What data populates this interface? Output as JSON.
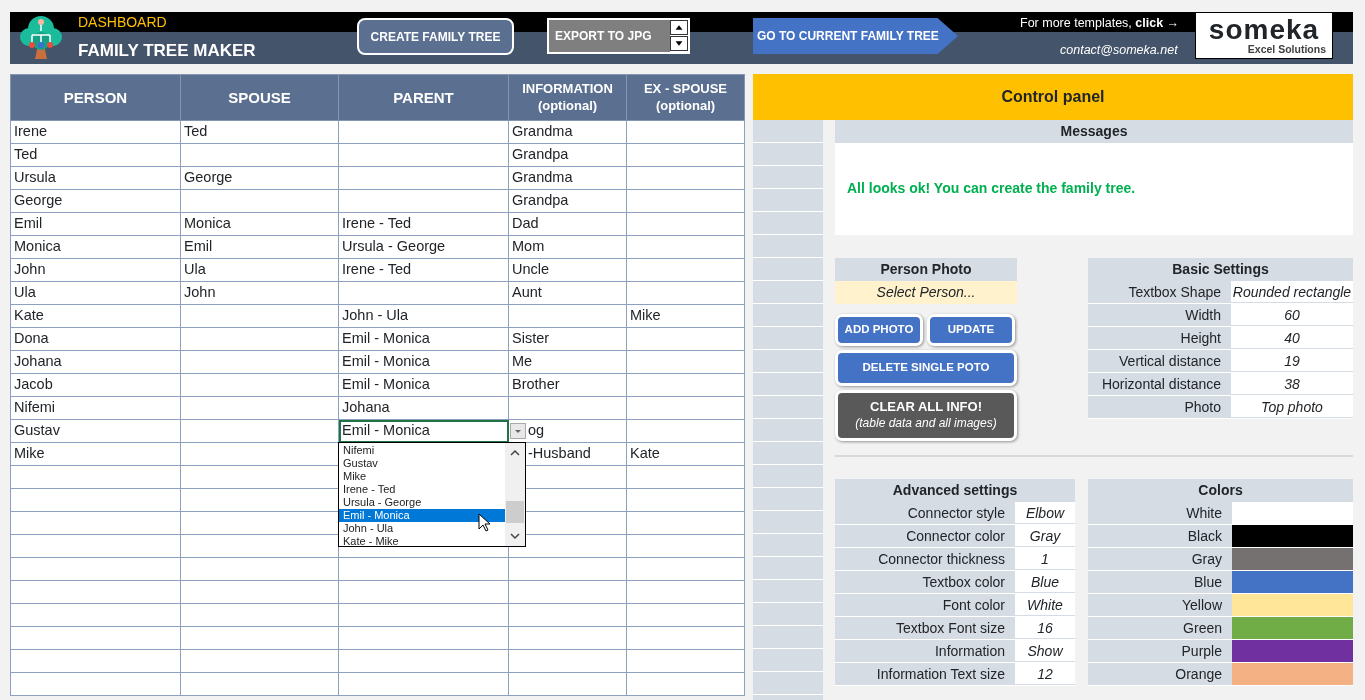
{
  "header": {
    "section": "DASHBOARD",
    "title": "FAMILY TREE MAKER",
    "create_button": "CREATE FAMILY TREE",
    "export_button": "EXPORT TO JPG",
    "go_button": "GO TO  CURRENT FAMILY TREE",
    "more_templates": "For more templates, **click** →",
    "contact": "contact@someka.net",
    "logo": {
      "name": "someka",
      "tagline": "Excel Solutions"
    }
  },
  "table": {
    "columns": [
      "PERSON",
      "SPOUSE",
      "PARENT",
      "INFORMATION (optional)",
      "EX - SPOUSE (optional)"
    ],
    "rows": [
      {
        "person": "Irene",
        "spouse": "Ted",
        "information": "Grandma"
      },
      {
        "person": "Ted",
        "information": "Grandpa"
      },
      {
        "person": "Ursula",
        "spouse": "George",
        "information": "Grandma"
      },
      {
        "person": "George",
        "information": "Grandpa"
      },
      {
        "person": "Emil",
        "spouse": "Monica",
        "parent": "Irene - Ted",
        "information": "Dad"
      },
      {
        "person": "Monica",
        "spouse": "Emil",
        "parent": "Ursula - George",
        "information": "Mom"
      },
      {
        "person": "John",
        "spouse": "Ula",
        "parent": "Irene - Ted",
        "information": "Uncle"
      },
      {
        "person": "Ula",
        "spouse": "John",
        "information": "Aunt"
      },
      {
        "person": "Kate",
        "parent": "John - Ula",
        "ex_spouse": "Mike"
      },
      {
        "person": "Dona",
        "parent": "Emil - Monica",
        "information": "Sister"
      },
      {
        "person": "Johana",
        "parent": "Emil - Monica",
        "information": "Me"
      },
      {
        "person": "Jacob",
        "parent": "Emil - Monica",
        "information": "Brother"
      },
      {
        "person": "Nifemi",
        "parent": "Johana"
      },
      {
        "person": "Gustav",
        "parent": "Emil - Monica",
        "information": "og",
        "parent_dropdown": [
          {
            "label": "Nifemi",
            "selected": false
          },
          {
            "label": "Gustav",
            "selected": false
          },
          {
            "label": "Mike",
            "selected": false
          },
          {
            "label": "Irene - Ted",
            "selected": false
          },
          {
            "label": "Ursula - George",
            "selected": false
          },
          {
            "label": "Emil - Monica",
            "selected": true
          },
          {
            "label": "John - Ula",
            "selected": false
          },
          {
            "label": "Kate - Mike",
            "selected": false
          }
        ]
      },
      {
        "person": "Mike",
        "information": "-Husband",
        "ex_spouse": "Kate"
      }
    ]
  },
  "control_panel": {
    "title": "Control panel",
    "messages": {
      "title": "Messages",
      "text": "All looks ok! You can create the family tree."
    },
    "person_photo": {
      "title": "Person Photo",
      "placeholder": "Select Person..."
    },
    "buttons": [
      {
        "kind": "small",
        "label": "ADD PHOTO"
      },
      {
        "kind": "small",
        "label": "UPDATE"
      },
      {
        "kind": "wide",
        "label": "DELETE SINGLE POTO"
      },
      {
        "kind": "danger",
        "label": "CLEAR ALL INFO!",
        "note": "(table data and all images)"
      }
    ],
    "basic_settings": {
      "title": "Basic Settings",
      "rows": [
        {
          "label": "Textbox Shape",
          "value": "Rounded rectangle"
        },
        {
          "label": "Width",
          "value": "60"
        },
        {
          "label": "Height",
          "value": "40"
        },
        {
          "label": "Vertical distance",
          "value": "19"
        },
        {
          "label": "Horizontal distance",
          "value": "38"
        },
        {
          "label": "Photo",
          "value": "Top photo"
        }
      ]
    },
    "advanced_settings": {
      "title": "Advanced settings",
      "rows": [
        {
          "label": "Connector style",
          "value": "Elbow"
        },
        {
          "label": "Connector color",
          "value": "Gray"
        },
        {
          "label": "Connector thickness",
          "value": "1"
        },
        {
          "label": "Textbox color",
          "value": "Blue"
        },
        {
          "label": "Font color",
          "value": "White"
        },
        {
          "label": "Textbox Font size",
          "value": "16"
        },
        {
          "label": "Information",
          "value": "Show"
        },
        {
          "label": "Information Text size",
          "value": "12"
        }
      ]
    },
    "colors": {
      "title": "Colors",
      "rows": [
        {
          "label": "White",
          "color": "#ffffff"
        },
        {
          "label": "Black",
          "color": "#000000"
        },
        {
          "label": "Gray",
          "color": "#767171"
        },
        {
          "label": "Blue",
          "color": "#4472c4"
        },
        {
          "label": "Yellow",
          "color": "#ffe699"
        },
        {
          "label": "Green",
          "color": "#70ad47"
        },
        {
          "label": "Purple",
          "color": "#7030a0"
        },
        {
          "label": "Orange",
          "color": "#f4b183"
        }
      ]
    }
  }
}
